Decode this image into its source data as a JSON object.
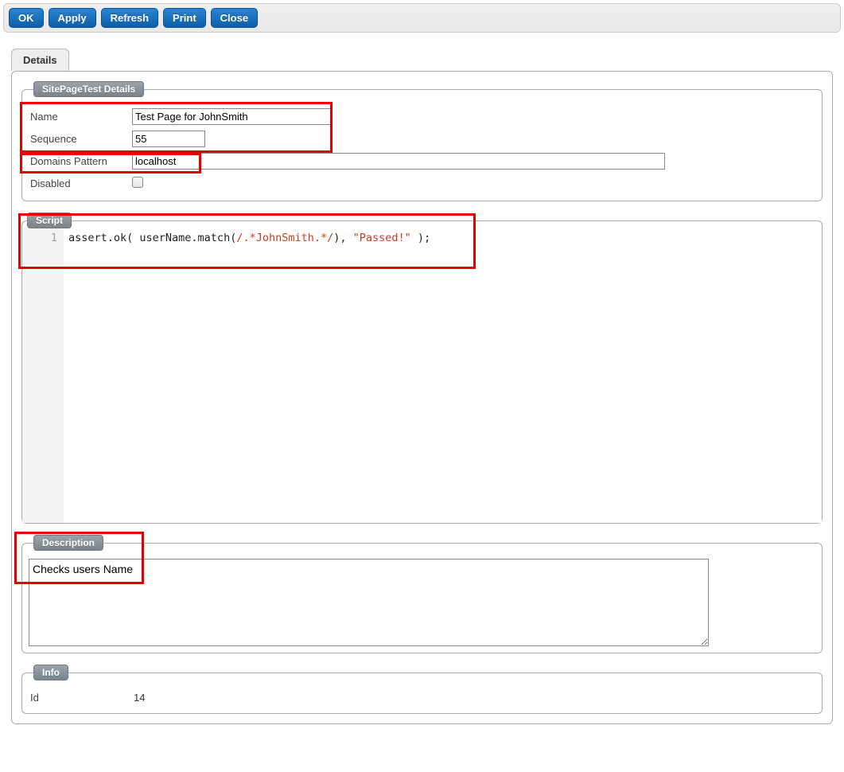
{
  "toolbar": {
    "ok": "OK",
    "apply": "Apply",
    "refresh": "Refresh",
    "print": "Print",
    "close": "Close"
  },
  "tabs": {
    "details": "Details"
  },
  "groups": {
    "details": {
      "legend": "SitePageTest Details"
    },
    "script": {
      "legend": "Script"
    },
    "description": {
      "legend": "Description"
    },
    "info": {
      "legend": "Info"
    }
  },
  "labels": {
    "name": "Name",
    "sequence": "Sequence",
    "domains": "Domains Pattern",
    "disabled": "Disabled",
    "id": "Id"
  },
  "fields": {
    "name": "Test Page for JohnSmith",
    "sequence": "55",
    "domains": "localhost",
    "disabled": false,
    "description": "Checks users Name",
    "id": "14"
  },
  "script": {
    "line_no": "1",
    "pre": "assert.ok( userName.match(",
    "regex": "/.*JohnSmith.*/",
    "mid": "), ",
    "str": "\"Passed!\"",
    "post": " );"
  }
}
